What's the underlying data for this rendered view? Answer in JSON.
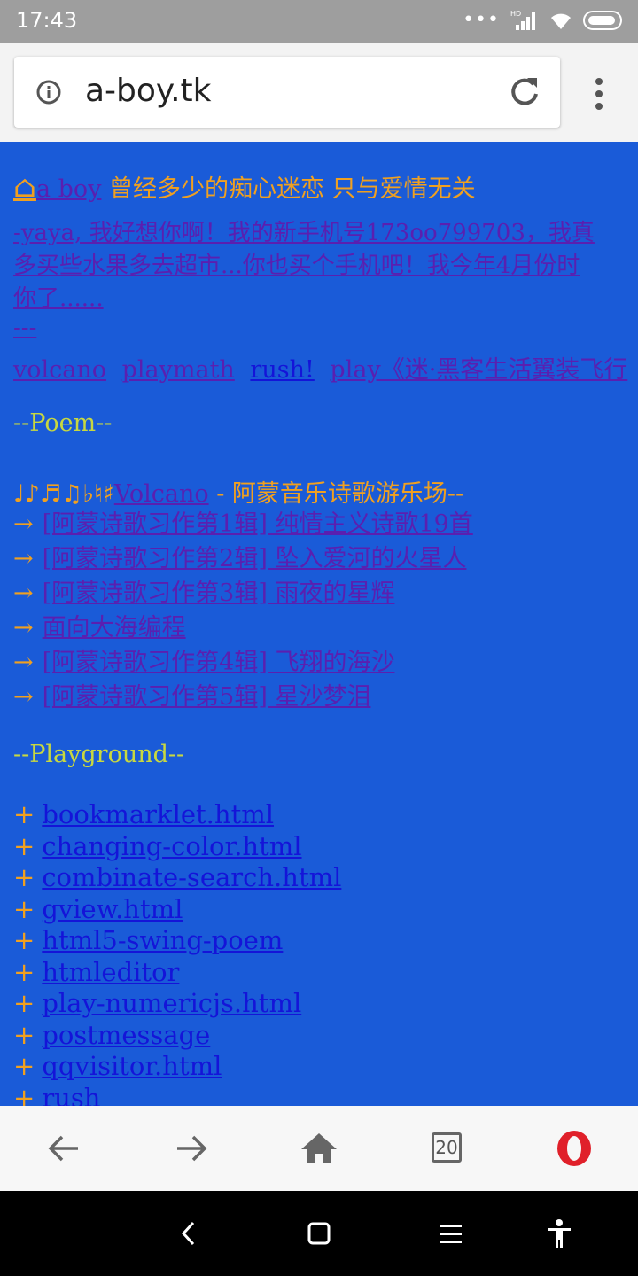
{
  "status": {
    "time": "17:43",
    "dots": "•••",
    "hd": "HD"
  },
  "browser": {
    "url": "a-boy.tk",
    "tab_count": "20"
  },
  "header": {
    "home_glyph": "⌂",
    "site_link": "a boy",
    "tagline": " 曾经多少的痴心迷恋 只与爱情无关"
  },
  "notice": {
    "lines": [
      "-yaya, 我好想你啊！我的新手机号173oo799703，我真",
      "多买些水果多去超市...你也买个手机吧！我今年4月份时",
      "你了......"
    ],
    "separator": "---"
  },
  "links": [
    "volcano",
    "playmath",
    "rush!",
    "play《迷·黑客生活翼装飞行"
  ],
  "poem_section": {
    "title": "--Poem--",
    "music_notes": "♩♪♬♫♭♮♯",
    "volcano_link": "Volcano",
    "subtitle": " - 阿蒙音乐诗歌游乐场--",
    "arrow": "→",
    "items": [
      "[阿蒙诗歌习作第1辑] 纯情主义诗歌19首",
      "[阿蒙诗歌习作第2辑] 坠入爱河的火星人",
      "[阿蒙诗歌习作第3辑] 雨夜的星辉",
      "面向大海编程",
      "[阿蒙诗歌习作第4辑] 飞翔的海沙",
      "[阿蒙诗歌习作第5辑] 星沙梦泪"
    ]
  },
  "playground": {
    "title": "--Playground--",
    "plus": "+",
    "items": [
      "bookmarklet.html",
      "changing-color.html",
      "combinate-search.html",
      "gview.html",
      "html5-swing-poem",
      "htmleditor",
      "play-numericjs.html",
      "postmessage",
      "qqvisitor.html",
      "rush"
    ]
  },
  "colors": {
    "page_bg": "#1a5bd8",
    "orange": "#f0a020",
    "visited": "#5a1fb0",
    "link": "#1414d8",
    "section": "#c8d840",
    "opera_red": "#e0202a"
  }
}
